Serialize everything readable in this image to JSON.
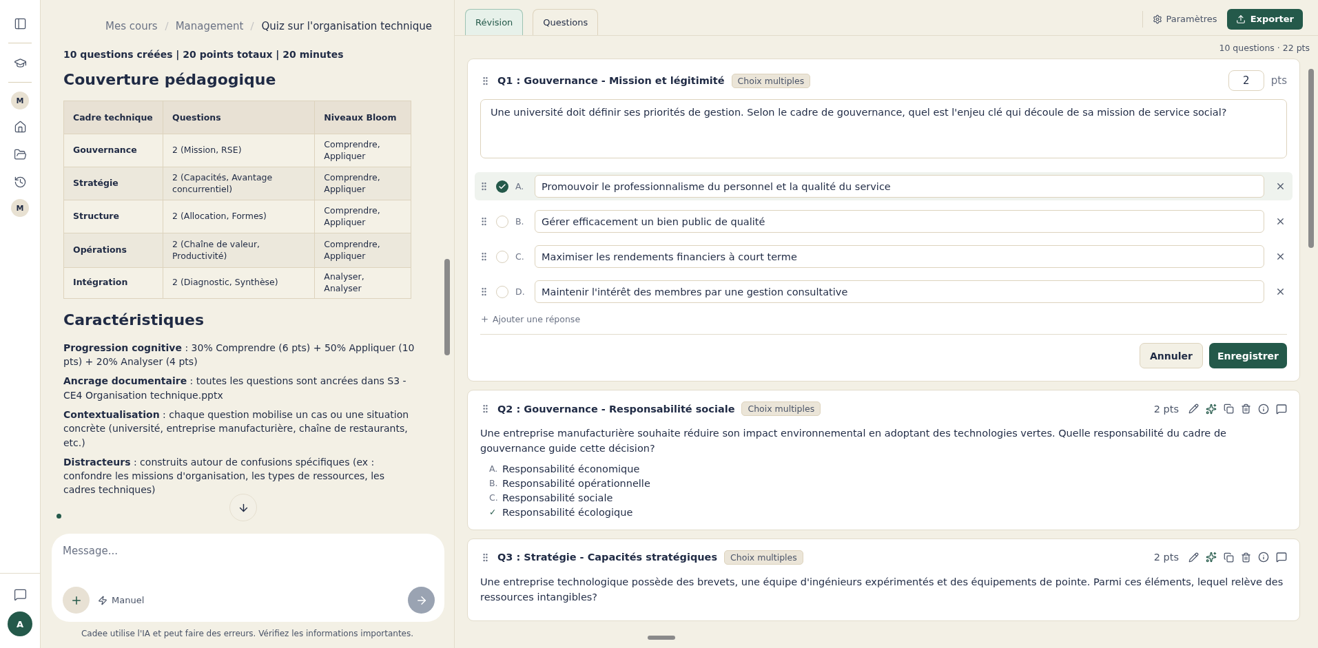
{
  "sidebar": {
    "top_items": [
      {
        "kind": "panel"
      },
      {
        "kind": "course"
      },
      {
        "kind": "avatar",
        "label": "M"
      },
      {
        "kind": "home"
      },
      {
        "kind": "folder"
      },
      {
        "kind": "history"
      },
      {
        "kind": "avatar",
        "label": "M"
      }
    ],
    "user": {
      "initial": "A"
    }
  },
  "breadcrumbs": [
    {
      "label": "Mes cours",
      "current": false
    },
    {
      "label": "Management",
      "current": false
    },
    {
      "label": "Quiz sur l'organisation technique",
      "current": true
    }
  ],
  "summary": "10 questions créées | 20 points totaux | 20 minutes",
  "coverage": {
    "title": "Couverture pédagogique",
    "columns": [
      "Cadre technique",
      "Questions",
      "Niveaux Bloom"
    ],
    "rows": [
      [
        "Gouvernance",
        "2 (Mission, RSE)",
        "Comprendre, Appliquer"
      ],
      [
        "Stratégie",
        "2 (Capacités, Avantage concurrentiel)",
        "Comprendre, Appliquer"
      ],
      [
        "Structure",
        "2 (Allocation, Formes)",
        "Comprendre, Appliquer"
      ],
      [
        "Opérations",
        "2 (Chaîne de valeur, Productivité)",
        "Comprendre, Appliquer"
      ],
      [
        "Intégration",
        "2 (Diagnostic, Synthèse)",
        "Analyser, Analyser"
      ]
    ]
  },
  "features": {
    "title": "Caractéristiques",
    "paragraphs": [
      "**Progression cognitive** : 30% Comprendre (6 pts) + 50% Appliquer (10 pts) + 20% Analyser (4 pts)",
      "**Ancrage documentaire** : toutes les questions sont ancrées dans S3 - CE4 Organisation technique.pptx",
      "**Contextualisation** : chaque question mobilise un cas ou une situation concrète (université, entreprise manufacturière, chaîne de restaurants, etc.)",
      "**Distracteurs** : construits autour de confusions spécifiques (ex : confondre les missions d'organisation, les types de ressources, les cadres techniques)"
    ]
  },
  "chat": {
    "placeholder": "Message...",
    "mode": "Manuel",
    "disclaimer": "Cadee utilise l'IA et peut faire des erreurs. Vérifiez les informations importantes."
  },
  "tabs": [
    {
      "label": "Révision",
      "selected": true
    },
    {
      "label": "Questions",
      "selected": false
    }
  ],
  "actions": {
    "settings": "Paramètres",
    "export": "Exporter"
  },
  "totals": "10 questions · 22 pts",
  "questions": [
    {
      "kind": "editing",
      "title": "Q1 : Gouvernance - Mission et légitimité",
      "type": "Choix multiples",
      "points": "2",
      "points_unit": "pts",
      "text": "Une université doit définir ses priorités de gestion. Selon le cadre de gouvernance, quel est l'enjeu clé qui découle de sa mission de service social?",
      "answers": [
        {
          "marker": "A.",
          "text": "Promouvoir le professionnalisme du personnel et la qualité du service",
          "correct": true
        },
        {
          "marker": "B.",
          "text": "Gérer efficacement un bien public de qualité",
          "correct": false
        },
        {
          "marker": "C.",
          "text": "Maximiser les rendements financiers à court terme",
          "correct": false
        },
        {
          "marker": "D.",
          "text": "Maintenir l'intérêt des membres par une gestion consultative",
          "correct": false
        }
      ],
      "add_answer": "Ajouter une réponse",
      "cancel": "Annuler",
      "save": "Enregistrer"
    },
    {
      "kind": "view",
      "title": "Q2 : Gouvernance - Responsabilité sociale",
      "type": "Choix multiples",
      "points": "2 pts",
      "text": "Une entreprise manufacturière souhaite réduire son impact environnemental en adoptant des technologies vertes. Quelle responsabilité du cadre de gouvernance guide cette décision?",
      "answers": [
        {
          "marker": "A.",
          "text": "Responsabilité économique",
          "correct": false
        },
        {
          "marker": "B.",
          "text": "Responsabilité opérationnelle",
          "correct": false
        },
        {
          "marker": "C.",
          "text": "Responsabilité sociale",
          "correct": false
        },
        {
          "marker": "✓",
          "text": "Responsabilité écologique",
          "correct": true
        }
      ]
    },
    {
      "kind": "view",
      "title": "Q3 : Stratégie - Capacités stratégiques",
      "type": "Choix multiples",
      "points": "2 pts",
      "text": "Une entreprise technologique possède des brevets, une équipe d'ingénieurs expérimentés et des équipements de pointe. Parmi ces éléments, lequel relève des ressources intangibles?"
    }
  ]
}
